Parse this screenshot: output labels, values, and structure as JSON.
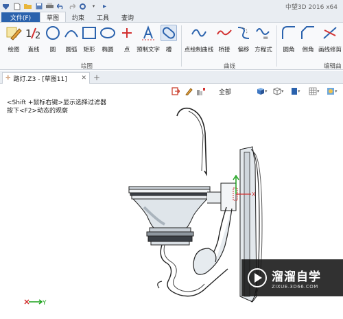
{
  "app": {
    "title": "中望3D 2016  x64"
  },
  "ribbon_tabs": [
    {
      "label": "文件(F)"
    },
    {
      "label": "草图"
    },
    {
      "label": "约束"
    },
    {
      "label": "工具"
    },
    {
      "label": "查询"
    }
  ],
  "ribbon": {
    "draw_group": {
      "label": "绘图",
      "tools": [
        {
          "label": "绘图",
          "icon": "pencil-icon"
        },
        {
          "label": "直线",
          "icon": "line-icon"
        },
        {
          "label": "圆",
          "icon": "circle-icon"
        },
        {
          "label": "圆弧",
          "icon": "arc-icon"
        },
        {
          "label": "矩形",
          "icon": "rectangle-icon"
        },
        {
          "label": "椭圆",
          "icon": "ellipse-icon"
        },
        {
          "label": "点",
          "icon": "point-icon"
        },
        {
          "label": "预制文字",
          "icon": "text-icon"
        },
        {
          "label": "槽",
          "icon": "slot-icon"
        }
      ]
    },
    "curve_group": {
      "label": "曲线",
      "tools": [
        {
          "label": "点绘制曲线",
          "icon": "spline-icon"
        },
        {
          "label": "桥接",
          "icon": "bridge-icon"
        },
        {
          "label": "偏移",
          "icon": "offset-icon"
        },
        {
          "label": "方程式",
          "icon": "equation-icon"
        }
      ]
    },
    "edit_group": {
      "label": "编辑曲",
      "tools": [
        {
          "label": "圆角",
          "icon": "fillet-icon"
        },
        {
          "label": "倒角",
          "icon": "chamfer-icon"
        },
        {
          "label": "画线修剪",
          "icon": "trim-icon"
        }
      ]
    }
  },
  "document": {
    "tab_label": "路灯.Z3 - [草图11]",
    "new_tab": "+"
  },
  "view_toolbar": {
    "filter_label": "全部"
  },
  "hints": {
    "line1": "<Shift +鼠标右键>显示选择过滤器",
    "line2": "按下<F2>动态的观察"
  },
  "axis": {
    "y_label": "Y",
    "x_label": "X"
  },
  "watermark": {
    "title": "溜溜自学",
    "subtitle": "ZIXUE.3D66.COM"
  },
  "colors": {
    "accent": "#2a62ad",
    "axis_green": "#1aa11a",
    "axis_red": "#d23030"
  }
}
